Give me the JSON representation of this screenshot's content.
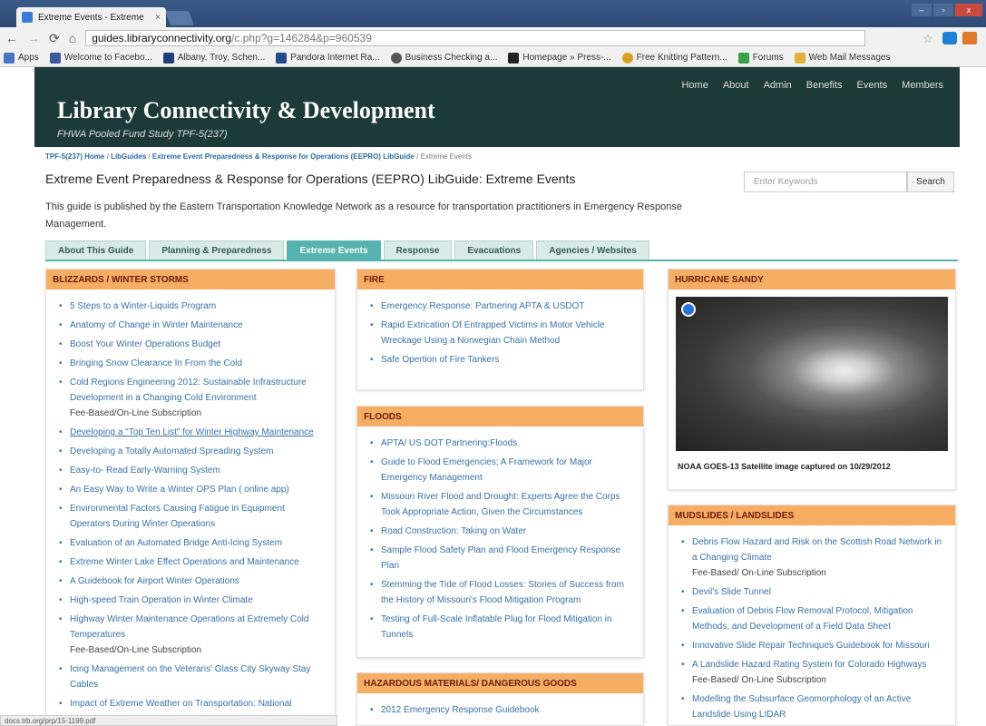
{
  "browser": {
    "tab_title": "Extreme Events - Extreme",
    "tab_close": "×",
    "url_domain": "guides.libraryconnectivity.org",
    "url_path": "/c.php?g=146284&p=960539",
    "win_controls": [
      "–",
      "▫",
      "x"
    ]
  },
  "bookmarks": [
    "Apps",
    "Welcome to Facebo...",
    "Albany, Troy, Schen...",
    "Pandora Internet Ra...",
    "Business Checking a...",
    "Homepage » Press-...",
    "Free Knitting Pattern...",
    "Forums",
    "Web Mail Messages"
  ],
  "header": {
    "title": "Library Connectivity & Development",
    "subtitle": "FHWA Pooled Fund Study TPF-5(237)",
    "nav": [
      "Home",
      "About",
      "Admin",
      "Benefits",
      "Events",
      "Members"
    ]
  },
  "breadcrumb": {
    "items": [
      "TPF-5(237) Home",
      "LibGuides",
      "Extreme Event Preparedness & Response for Operations (EEPRO) LibGuide"
    ],
    "current": "Extreme Events",
    "sep": "/"
  },
  "guide": {
    "title": "Extreme Event Preparedness & Response for Operations (EEPRO) LibGuide: Extreme Events",
    "description": "This guide is published by the Eastern Transportation Knowledge Network as a resource for transportation practitioners in Emergency Response Management."
  },
  "search": {
    "placeholder": "Enter Keywords",
    "button": "Search"
  },
  "tabs": [
    "About This Guide",
    "Planning & Preparedness",
    "Extreme Events",
    "Response",
    "Evacuations",
    "Agencies / Websites"
  ],
  "blizzards": {
    "title": "BLIZZARDS / WINTER STORMS",
    "items": [
      {
        "t": "5 Steps to a Winter-Liquids Program"
      },
      {
        "t": "Anatomy of Change in Winter Maintenance"
      },
      {
        "t": "Boost Your Winter Operations Budget"
      },
      {
        "t": "Bringing Snow Clearance In From the Cold"
      },
      {
        "t": "Cold Regions Engineering 2012: Sustainable Infrastructure Development in a Changing Cold Environment",
        "n": "Fee-Based/On-Line Subscription"
      },
      {
        "t": "Developing a \"Top Ten List\" for Winter Highway Maintenance"
      },
      {
        "t": "Developing a Totally Automated Spreading System"
      },
      {
        "t": "Easy-to- Read Early-Warning System"
      },
      {
        "t": "An Easy Way to Write a Winter OPS Plan ( online app)"
      },
      {
        "t": "Environmental Factors Causing Fatigue in Equipment Operators During Winter Operations"
      },
      {
        "t": "Evaluation of an Automated Bridge Anti-Icing System"
      },
      {
        "t": "Extreme Winter Lake Effect Operations and Maintenance"
      },
      {
        "t": "A Guidebook for Airport Winter Operations"
      },
      {
        "t": "High-speed Train Operation in Winter Climate"
      },
      {
        "t": "Highway Winter Maintenance Operations at Extremely Cold Temperatures",
        "n": "Fee-Based/On-Line Subscription"
      },
      {
        "t": "Icing Management on the Veterans' Glass City Skyway Stay Cables"
      },
      {
        "t": "Impact of Extreme Weather on Transportation: National"
      }
    ]
  },
  "fire": {
    "title": "FIRE",
    "items": [
      {
        "t": "Emergency Response: Partnering APTA & USDOT"
      },
      {
        "t": "Rapid Extrication Of Entrapped Victims in Motor Vehicle Wreckage Using a Norwegian Chain Method"
      },
      {
        "t": "Safe Opertion of Fire Tankers"
      }
    ]
  },
  "floods": {
    "title": "FLOODS",
    "items": [
      {
        "t": "APTA/ US DOT Partnering:Floods"
      },
      {
        "t": "Guide to Flood Emergencies; A Framework for Major Emergency Management"
      },
      {
        "t": "Missouri River Flood and Drought: Experts Agree the Corps Took Appropriate Action, Given the Circumstances"
      },
      {
        "t": "Road Construction: Taking on Water"
      },
      {
        "t": "Sample Flood Safety Plan and Flood Emergency Response Plan"
      },
      {
        "t": "Stemming the Tide of Flood Losses: Stories of Success from the History of Missouri's Flood Mitigation Program"
      },
      {
        "t": "Testing of Full-Scale Inflatable Plug for Flood Mitigation in Tunnels"
      }
    ]
  },
  "hazmat": {
    "title": "HAZARDOUS MATERIALS/ DANGEROUS GOODS",
    "items": [
      {
        "t": "2012 Emergency Response Guidebook"
      }
    ]
  },
  "sandy": {
    "title": "HURRICANE SANDY",
    "caption": "NOAA GOES-13 Satellite image captured on 10/29/2012"
  },
  "mudslides": {
    "title": "MUDSLIDES / LANDSLIDES",
    "items": [
      {
        "t": "Debris Flow Hazard and Risk on the Scottish Road Network in a Changing Climate",
        "n": "Fee-Based/ On-Line Subscription"
      },
      {
        "t": "Devil's Slide Tunnel"
      },
      {
        "t": "Evaluation of Debris Flow Removal Protocol, Mitigation Methods, and Development of a Field Data Sheet"
      },
      {
        "t": "Innovative Slide Repair Techniques Guidebook for Missouri"
      },
      {
        "t": "A Landslide Hazard Rating System for Colorado Highways",
        "n": "Fee-Based/ On-Line Subscription"
      },
      {
        "t": "Modelling the Subsurface Geomorphology of an Active Landslide Using LIDAR"
      }
    ]
  },
  "status": "docs.trb.org/prp/15-1199.pdf"
}
